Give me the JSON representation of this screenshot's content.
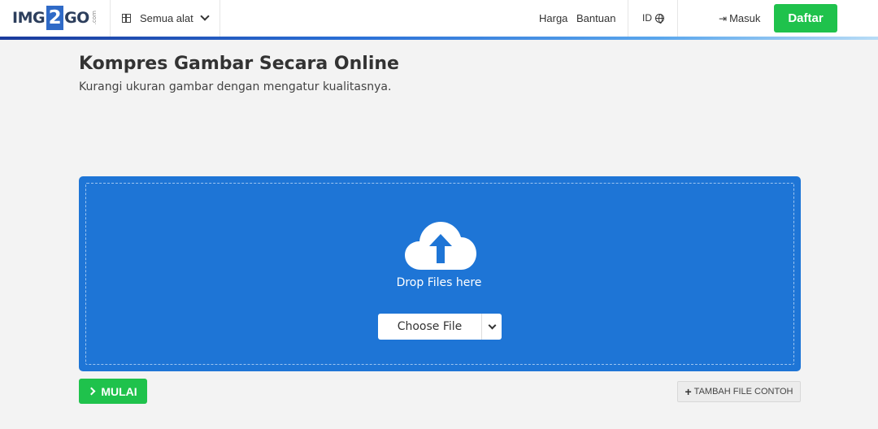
{
  "header": {
    "logo": {
      "left": "IMG",
      "middle": "2",
      "right": "GO",
      "suffix": ".com"
    },
    "tools_label": "Semua alat",
    "nav": {
      "pricing": "Harga",
      "help": "Bantuan"
    },
    "language": "ID",
    "login": "Masuk",
    "signup": "Daftar"
  },
  "page": {
    "title": "Kompres Gambar Secara Online",
    "subtitle": "Kurangi ukuran gambar dengan mengatur kualitasnya."
  },
  "upload": {
    "drop_text": "Drop Files here",
    "choose_file": "Choose File"
  },
  "actions": {
    "start": "MULAI",
    "add_sample": "TAMBAH FILE CONTOH"
  },
  "colors": {
    "brand_blue": "#1e75d6",
    "brand_green": "#1fc24c"
  }
}
